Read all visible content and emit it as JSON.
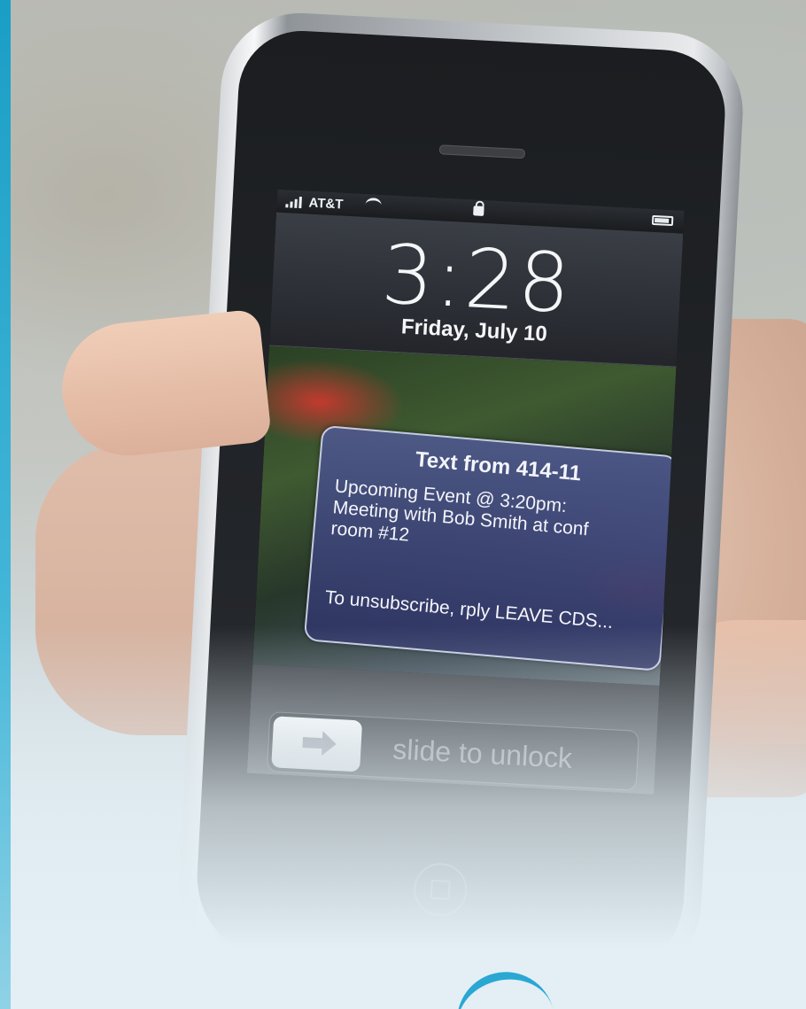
{
  "lock_screen": {
    "carrier": "AT&T",
    "time": "3:28",
    "date": "Friday, July 10",
    "battery_level": 0.9,
    "notification": {
      "title": "Text from 414-11",
      "body_lines": [
        "Upcoming Event @ 3:20pm:",
        "Meeting with Bob Smith at conf",
        "room #12"
      ],
      "footer": "To unsubscribe, rply LEAVE CDS..."
    },
    "slider_label": "slide to unlock"
  },
  "colors": {
    "accent_blue": "#1a9ec6",
    "notification_bg": "#3e4680"
  },
  "icons": [
    "signal-icon",
    "wifi-icon",
    "lock-icon",
    "battery-icon",
    "arrow-icon",
    "home-button-icon"
  ]
}
